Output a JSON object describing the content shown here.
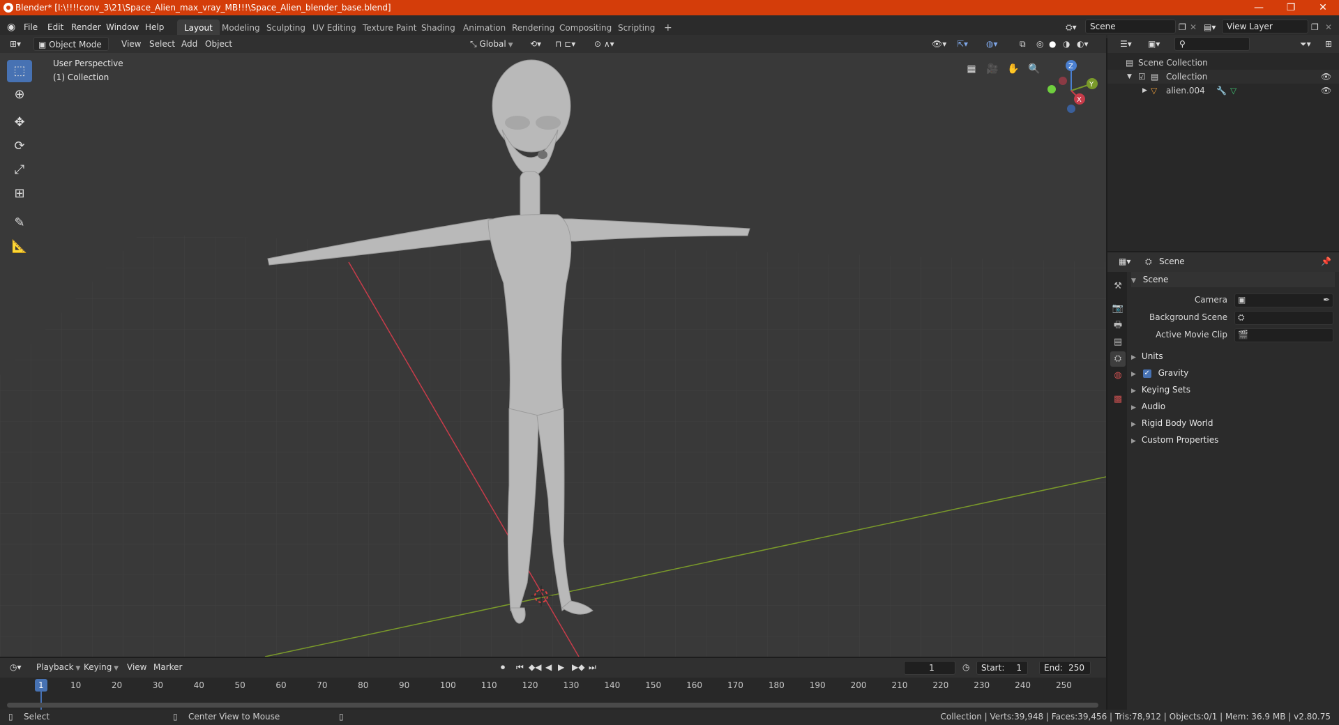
{
  "window": {
    "title": "Blender* [I:\\!!!!conv_3\\21\\Space_Alien_max_vray_MB!!!\\Space_Alien_blender_base.blend]",
    "minimize": "—",
    "maximize": "❐",
    "close": "✕"
  },
  "menu": [
    "File",
    "Edit",
    "Render",
    "Window",
    "Help"
  ],
  "workspaces": [
    "Layout",
    "Modeling",
    "Sculpting",
    "UV Editing",
    "Texture Paint",
    "Shading",
    "Animation",
    "Rendering",
    "Compositing",
    "Scripting"
  ],
  "workspace_add": "+",
  "scene_field": "Scene",
  "viewlayer_field": "View Layer",
  "viewport_header": {
    "mode": "Object Mode",
    "menus": [
      "View",
      "Select",
      "Add",
      "Object"
    ],
    "transform": "Global"
  },
  "viewport": {
    "perspective": "User Perspective",
    "collection": "(1) Collection",
    "gizmo": {
      "z": "Z",
      "y": "Y",
      "x": "X"
    }
  },
  "outliner": {
    "root": "Scene Collection",
    "collection": "Collection",
    "object": "alien.004"
  },
  "properties": {
    "header": "Scene",
    "panel": "Scene",
    "camera_label": "Camera",
    "bg_scene_label": "Background Scene",
    "movie_clip_label": "Active Movie Clip",
    "sections": [
      "Units",
      "Gravity",
      "Keying Sets",
      "Audio",
      "Rigid Body World",
      "Custom Properties"
    ]
  },
  "timeline": {
    "menus": [
      "Playback",
      "Keying",
      "View",
      "Marker"
    ],
    "current_frame": "1",
    "start_label": "Start:",
    "start": "1",
    "end_label": "End:",
    "end": "250",
    "ticks": [
      "1",
      "10",
      "20",
      "30",
      "40",
      "50",
      "60",
      "70",
      "80",
      "90",
      "100",
      "110",
      "120",
      "130",
      "140",
      "150",
      "160",
      "170",
      "180",
      "190",
      "200",
      "210",
      "220",
      "230",
      "240",
      "250"
    ]
  },
  "status": {
    "select": "Select",
    "center": "Center View to Mouse",
    "stats": "Collection | Verts:39,948 | Faces:39,456 | Tris:78,912 | Objects:0/1 | Mem: 36.9 MB | v2.80.75"
  },
  "colors": {
    "accent": "#4772b3",
    "titlebar": "#d43d0a",
    "x_axis": "#c83c4a",
    "y_axis": "#7a9a2a"
  }
}
